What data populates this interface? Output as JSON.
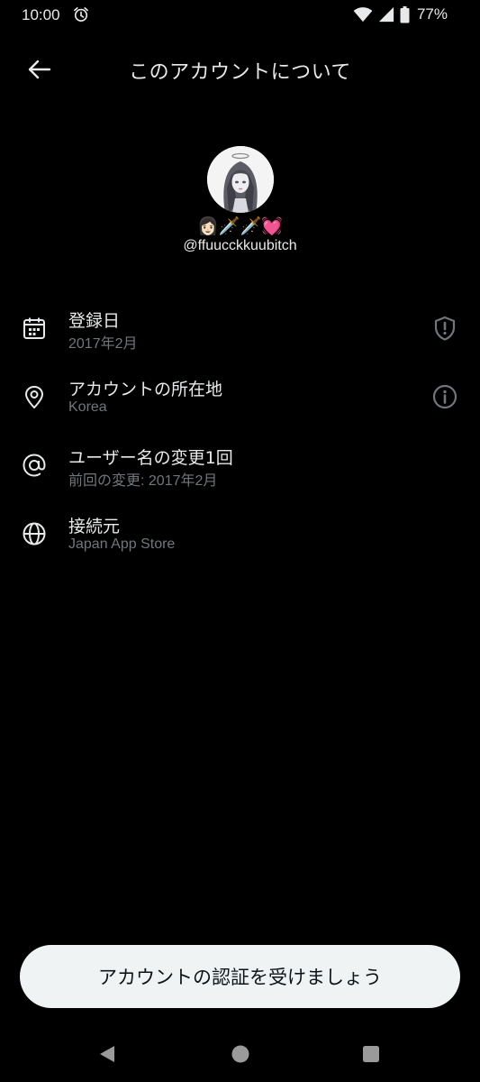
{
  "status_bar": {
    "time": "10:00",
    "battery": "77%"
  },
  "header": {
    "title": "このアカウントについて"
  },
  "profile": {
    "display_name": "👩🏻🗡️🗡️💓",
    "username": "@ffuucckkuubitch"
  },
  "info": [
    {
      "icon": "calendar-icon",
      "title": "登録日",
      "subtitle": "2017年2月",
      "action_icon": "shield-icon"
    },
    {
      "icon": "location-pin-icon",
      "title": "アカウントの所在地",
      "subtitle": "Korea",
      "action_icon": "info-icon"
    },
    {
      "icon": "at-sign-icon",
      "title": "ユーザー名の変更1回",
      "subtitle": "前回の変更: 2017年2月"
    },
    {
      "icon": "globe-icon",
      "title": "接続元",
      "subtitle": "Japan App Store"
    }
  ],
  "verify_button": {
    "label": "アカウントの認証を受けましょう"
  },
  "colors": {
    "background": "#000000",
    "text_primary": "#e7e9ea",
    "text_secondary": "#71767b",
    "button_bg": "#eff3f4",
    "button_text": "#0f1419"
  }
}
